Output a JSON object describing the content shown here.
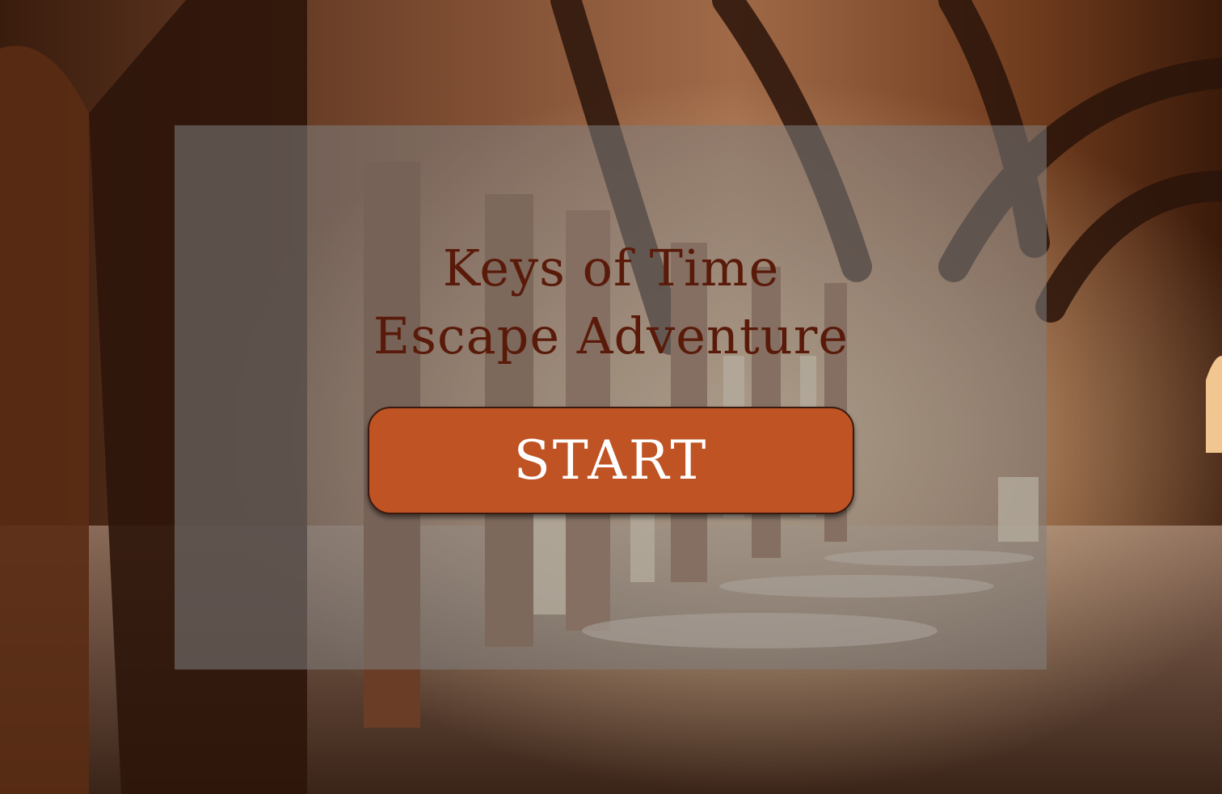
{
  "game": {
    "title_line1": "Keys of Time",
    "title_line2": "Escape Adventure",
    "start_label": "START"
  },
  "colors": {
    "title_text": "#5a1a0a",
    "button_fill": "#bf5324",
    "button_text": "#ffffff",
    "panel_overlay": "rgba(128,128,128,0.55)"
  },
  "background": {
    "scene": "vaulted-stone-hallway"
  }
}
